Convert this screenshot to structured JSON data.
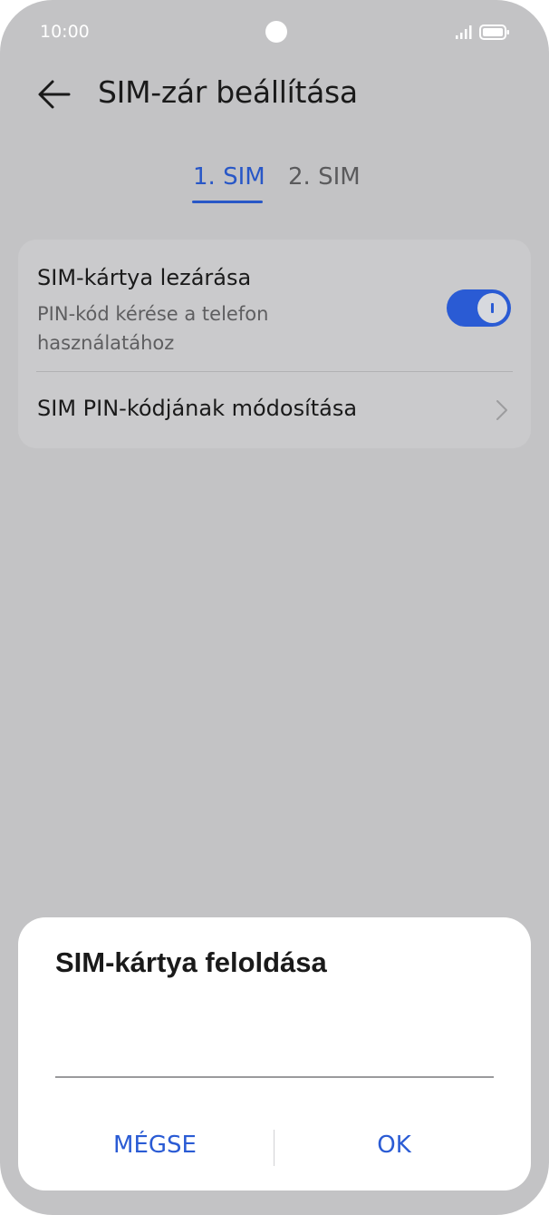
{
  "status_bar": {
    "time": "10:00"
  },
  "header": {
    "title": "SIM-zár beállítása",
    "back_icon": "arrow-left-icon"
  },
  "tabs": [
    {
      "label": "1. SIM",
      "selected": true
    },
    {
      "label": "2. SIM",
      "selected": false
    }
  ],
  "settings": {
    "lock_sim": {
      "title": "SIM-kártya lezárása",
      "subtitle": "PIN-kód kérése a telefon használatához",
      "enabled": true
    },
    "change_pin": {
      "title": "SIM PIN-kódjának módosítása"
    }
  },
  "dialog": {
    "title": "SIM-kártya feloldása",
    "input_value": "",
    "cancel_label": "MÉGSE",
    "ok_label": "OK"
  },
  "colors": {
    "accent": "#2a5bd4",
    "background": "#c3c3c5",
    "card": "#cacacc",
    "dialog": "#ffffff"
  }
}
